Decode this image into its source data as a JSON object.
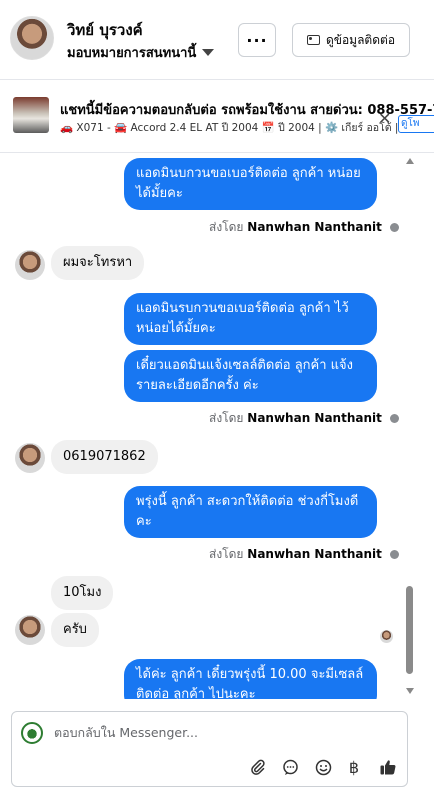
{
  "header": {
    "name": "วิทย์ บุรวงค์",
    "assign_label": "มอบหมายการสนทนานี้",
    "more_label": "···",
    "contact_label": "ดูข้อมูลติดต่อ"
  },
  "ad": {
    "title": "แชทนี้มีข้อความตอบกลับต่อ รถพร้อมใช้งาน สายด่วน: 088-557-7",
    "subtitle": "🚗 X071 - 🚘 Accord 2.4 EL AT ปี 2004 📅 ปี 2004 | ⚙️ เกียร์ ออโต้ | ...",
    "button_label": "ดูโพ"
  },
  "messages": {
    "m1": "แอดมินบกวนขอเบอร์ติดต่อ ลูกค้า หน่อยได้มั้ยคะ",
    "m1_sent_prefix": "ส่งโดย",
    "m1_sender": "Nanwhan Nanthanit",
    "m2": "ผมจะโทรหา",
    "m3": "แอดมินรบกวนขอเบอร์ติดต่อ ลูกค้า ไว้หน่อยได้มั้ยคะ",
    "m4": "เดี๋ยวแอดมินแจ้งเซลล์ติดต่อ ลูกค้า แจ้งรายละเอียดอีกครั้ง ค่ะ",
    "m4_sent_prefix": "ส่งโดย",
    "m4_sender": "Nanwhan Nanthanit",
    "m5": "0619071862",
    "m6": "พรุ่งนี้ ลูกค้า สะดวกให้ติดต่อ ช่วงกี่โมงดีคะ",
    "m6_sent_prefix": "ส่งโดย",
    "m6_sender": "Nanwhan Nanthanit",
    "m7": "10โมง",
    "m8": "ครับ",
    "m9": "ได้ค่ะ ลูกค้า เดี๋ยวพรุ่งนี้ 10.00 จะมีเซลล์ติดต่อ ลูกค้า ไปนะคะ"
  },
  "composer": {
    "placeholder": "ตอบกลับใน Messenger..."
  },
  "icons": {
    "attach": "paperclip-icon",
    "quick_reply": "speech-bubble-icon",
    "emoji": "smiley-icon",
    "payment": "baht-icon",
    "like": "thumbs-up-icon"
  },
  "colors": {
    "outgoing_bubble": "#1877f2",
    "incoming_bubble": "#f0f0f0",
    "accent": "#1877f2"
  }
}
